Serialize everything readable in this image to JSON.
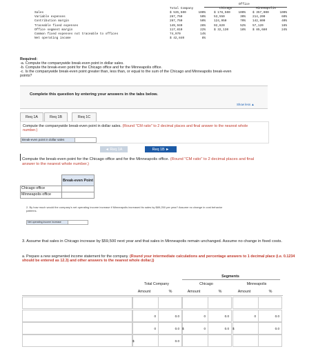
{
  "top_table": {
    "office_header": "Office",
    "col_headers": [
      "Total Company",
      "Chicago",
      "Minneapolis"
    ],
    "rows": [
      {
        "label": "Sales",
        "total": "$ 535,500",
        "total_pct": "100%",
        "chi": "$ 178,500",
        "chi_pct": "100%",
        "min": "$ 357,000",
        "min_pct": "100%"
      },
      {
        "label": "Variable expenses",
        "total": "267,750",
        "total_pct": "50%",
        "chi": "53,550",
        "chi_pct": "30%",
        "min": "214,200",
        "min_pct": "60%"
      },
      {
        "label": "Contribution margin",
        "total": "267,750",
        "total_pct": "50%",
        "chi": "124,950",
        "chi_pct": "70%",
        "min": "142,800",
        "min_pct": "40%"
      },
      {
        "label": "Traceable fixed expenses",
        "total": "149,940",
        "total_pct": "28%",
        "chi": "92,820",
        "chi_pct": "52%",
        "min": "57,120",
        "min_pct": "16%"
      },
      {
        "label": "Office segment margin",
        "total": "117,810",
        "total_pct": "22%",
        "chi": "$ 32,130",
        "chi_pct": "18%",
        "min": "$ 85,680",
        "min_pct": "24%"
      },
      {
        "label": "Common fixed expenses not traceable to offices",
        "total": "74,970",
        "total_pct": "14%",
        "chi": "",
        "chi_pct": "",
        "min": "",
        "min_pct": ""
      },
      {
        "label": "Net operating income",
        "total": "$ 42,840",
        "total_pct": "8%",
        "chi": "",
        "chi_pct": "",
        "min": "",
        "min_pct": ""
      }
    ]
  },
  "required": {
    "heading": "Required:",
    "a": "-a. Compute the companywide break-even point in dollar sales.",
    "b": "-b. Compute the break-even point for the Chicago office and for the Minneapolis office.",
    "c1": "-c. Is the companywide break-even point greater than, less than, or equal to the sum of the Chicago and Minneapolis break-even",
    "c2": "points?"
  },
  "instruction": "Complete this question by entering your answers in the tabs below.",
  "show_less": "Show less ▲",
  "tabs": [
    "Req 1A",
    "Req 1B",
    "Req 1C"
  ],
  "req1a": {
    "prompt": "Compute the companywide break-even point in dollar sales.",
    "note": "(Round \"CM ratio\" to 2 decimal places and final answer to the nearest whole number.)",
    "label": "Break-even point in dollar sales"
  },
  "nav": {
    "prev": "◄ Req 1A",
    "next": "Req 1B ►"
  },
  "req1b": {
    "prompt": "Compute the break-even point for the Chicago office and for the Minneapolis office.",
    "note": "(Round \"CM ratio\" to 2 decimal places and final answer to the nearest whole number.)",
    "col_header": "Break-even Point",
    "rows": [
      "Chicago office",
      "Minneapolis office"
    ]
  },
  "q2": {
    "text": "2. By how much would the company's net operating income increase if Minneapolis increased its sales by $89,250 per year? Assume no change in cost behavior patterns.",
    "label": "Net operating income increase"
  },
  "q3": {
    "text": "3. Assume that sales in Chicago increase by $59,500 next year and that sales in Minneapolis remain unchanged. Assume no change in fixed costs.",
    "a_prefix": "a. Prepare a new segmented income statement for the company.",
    "a_note": "(Round your intermediate calculations and percentage answers to 1 decimal place (i.e. 0.1234 should be entered as 12.3) and other answers to the nearest whole dollar.))"
  },
  "seg_table": {
    "segments_header": "Segments",
    "groups": [
      "Total Company",
      "Chicago",
      "Minneapolis"
    ],
    "sub": [
      "Amount",
      "%"
    ],
    "zero": "0",
    "zero_pct": "0.0",
    "dollar": "$"
  }
}
